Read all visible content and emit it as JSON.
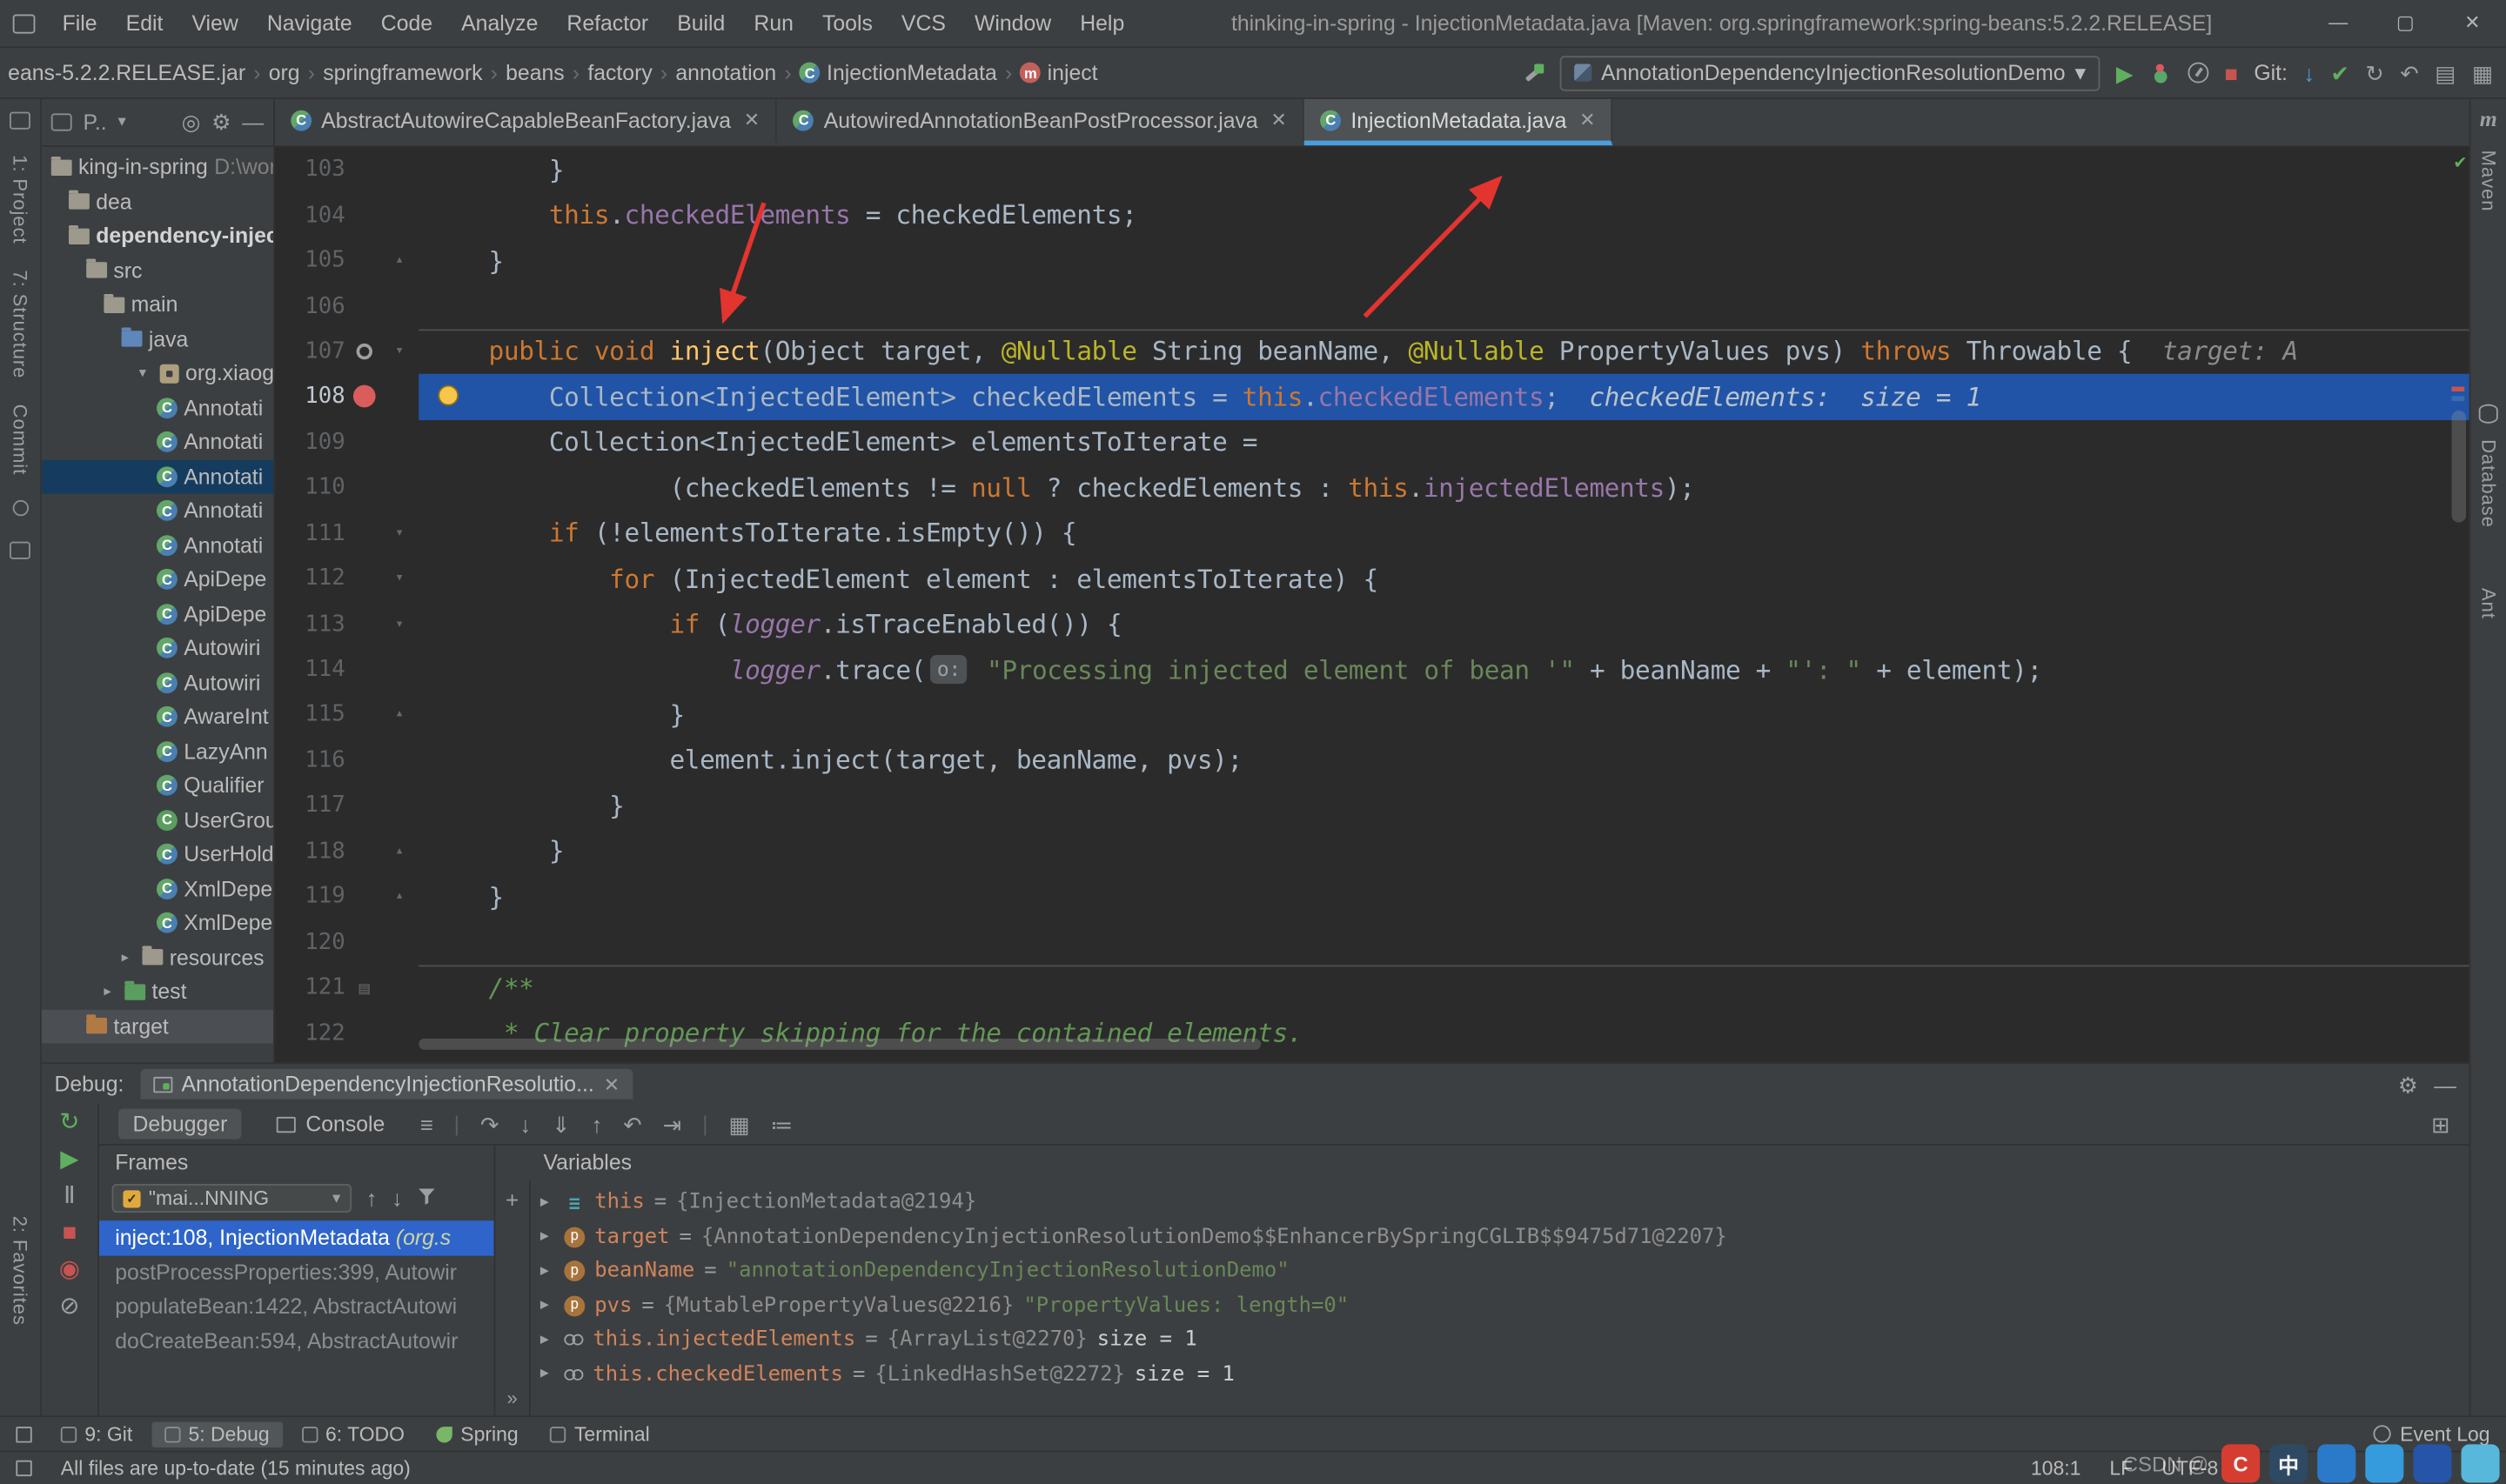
{
  "theme": {
    "editor_bg": "#2b2b2b",
    "panel_bg": "#3c3f41",
    "exec_line": "#2154a6",
    "breakpoint": "#db5c5c",
    "selection": "#2f65ca",
    "tab_underline": "#4a9edd",
    "keyword": "#cc7832",
    "string": "#6a8759",
    "field": "#9876aa",
    "comment": "#629755",
    "annotation": "#bbb529",
    "method": "#ffc66d",
    "annotation_arrow": "#e3342f"
  },
  "titlebar": {
    "menu": [
      "File",
      "Edit",
      "View",
      "Navigate",
      "Code",
      "Analyze",
      "Refactor",
      "Build",
      "Run",
      "Tools",
      "VCS",
      "Window",
      "Help"
    ],
    "title": "thinking-in-spring - InjectionMetadata.java [Maven: org.springframework:spring-beans:5.2.2.RELEASE]",
    "window_controls": [
      "minimize",
      "maximize",
      "close"
    ]
  },
  "navbar": {
    "breadcrumbs": [
      {
        "label": "eans-5.2.2.RELEASE.jar"
      },
      {
        "label": "org"
      },
      {
        "label": "springframework"
      },
      {
        "label": "beans"
      },
      {
        "label": "factory"
      },
      {
        "label": "annotation"
      },
      {
        "label": "InjectionMetadata",
        "icon": "class"
      },
      {
        "label": "inject",
        "icon": "method"
      }
    ],
    "run_config": "AnnotationDependencyInjectionResolutionDemo",
    "git_label": "Git:",
    "run_icons": [
      "run-icon",
      "debug-icon",
      "profiler-icon",
      "stop-icon"
    ],
    "git_icons": [
      "update-project-icon",
      "commit-icon",
      "history-icon",
      "rollback-icon"
    ],
    "right_icons": [
      "layout-icon",
      "hide-windows-icon"
    ]
  },
  "tabs": [
    {
      "label": "AbstractAutowireCapableBeanFactory.java",
      "active": false
    },
    {
      "label": "AutowiredAnnotationBeanPostProcessor.java",
      "active": false
    },
    {
      "label": "InjectionMetadata.java",
      "active": true
    }
  ],
  "left_stripe": {
    "top": [
      "1: Project",
      "7: Structure",
      "Commit"
    ],
    "bottom": [
      "2: Favorites"
    ]
  },
  "right_stripe": [
    "Maven",
    "Database",
    "Ant"
  ],
  "project": {
    "selector": "P..",
    "tree": [
      {
        "name": "king-in-spring",
        "suffix": " D:\\wor",
        "icon": "folder",
        "indent": 0
      },
      {
        "name": "dea",
        "icon": "folder",
        "indent": 1
      },
      {
        "name": "dependency-injection",
        "icon": "folder",
        "indent": 1,
        "bold": true
      },
      {
        "name": "src",
        "icon": "folder",
        "indent": 2
      },
      {
        "name": "main",
        "icon": "folder",
        "indent": 3
      },
      {
        "name": "java",
        "icon": "srcfolder",
        "indent": 4
      },
      {
        "name": "org.xiaoge.t",
        "icon": "package",
        "indent": 5,
        "arrow": "down"
      },
      {
        "name": "Annotati",
        "icon": "class",
        "indent": 6
      },
      {
        "name": "Annotati",
        "icon": "class",
        "indent": 6
      },
      {
        "name": "Annotati",
        "icon": "class",
        "indent": 6,
        "selected": "blue"
      },
      {
        "name": "Annotati",
        "icon": "class",
        "indent": 6
      },
      {
        "name": "Annotati",
        "icon": "class",
        "indent": 6
      },
      {
        "name": "ApiDepe",
        "icon": "class",
        "indent": 6
      },
      {
        "name": "ApiDepe",
        "icon": "class",
        "indent": 6
      },
      {
        "name": "Autowiri",
        "icon": "class",
        "indent": 6
      },
      {
        "name": "Autowiri",
        "icon": "class",
        "indent": 6
      },
      {
        "name": "AwareInt",
        "icon": "class",
        "indent": 6
      },
      {
        "name": "LazyAnn",
        "icon": "class",
        "indent": 6
      },
      {
        "name": "Qualifier",
        "icon": "class",
        "indent": 6
      },
      {
        "name": "UserGrou",
        "icon": "class-green",
        "indent": 6
      },
      {
        "name": "UserHold",
        "icon": "class",
        "indent": 6
      },
      {
        "name": "XmlDepe",
        "icon": "class",
        "indent": 6
      },
      {
        "name": "XmlDepe",
        "icon": "class",
        "indent": 6
      },
      {
        "name": "resources",
        "icon": "folder",
        "indent": 4,
        "arrow": "right"
      },
      {
        "name": "test",
        "icon": "folder-green",
        "indent": 3,
        "arrow": "right"
      },
      {
        "name": "target",
        "icon": "folder-excluded",
        "indent": 2,
        "selected": "gray"
      }
    ]
  },
  "editor": {
    "lines": [
      {
        "n": 103,
        "tokens": [
          [
            "t",
            "        }"
          ]
        ]
      },
      {
        "n": 104,
        "tokens": [
          [
            "t",
            "        "
          ],
          [
            "k",
            "this"
          ],
          [
            "t",
            "."
          ],
          [
            "f",
            "checkedElements"
          ],
          [
            "t",
            " = checkedElements;"
          ]
        ]
      },
      {
        "n": 105,
        "fold": "up",
        "tokens": [
          [
            "t",
            "    }"
          ]
        ]
      },
      {
        "n": 106,
        "tokens": []
      },
      {
        "n": 107,
        "sep": true,
        "fold": "down",
        "gicon": "method-marker-icon",
        "tokens": [
          [
            "t",
            "    "
          ],
          [
            "k",
            "public"
          ],
          [
            "t",
            " "
          ],
          [
            "k",
            "void"
          ],
          [
            "t",
            " "
          ],
          [
            "m",
            "inject"
          ],
          [
            "t",
            "(Object target, "
          ],
          [
            "a",
            "@Nullable"
          ],
          [
            "t",
            " String beanName, "
          ],
          [
            "a",
            "@Nullable"
          ],
          [
            "t",
            " PropertyValues pvs) "
          ],
          [
            "k",
            "throws"
          ],
          [
            "t",
            " Throwable {"
          ],
          [
            "h",
            "  target: A"
          ]
        ]
      },
      {
        "n": 108,
        "exec": true,
        "breakpoint": true,
        "bulb": true,
        "tokens": [
          [
            "t",
            "        Collection<InjectedElement> checkedElements = "
          ],
          [
            "k",
            "this"
          ],
          [
            "t",
            "."
          ],
          [
            "f",
            "checkedElements"
          ],
          [
            "t",
            ";"
          ],
          [
            "h2",
            "  checkedElements:  size = 1"
          ]
        ]
      },
      {
        "n": 109,
        "tokens": [
          [
            "t",
            "        Collection<InjectedElement> elementsToIterate ="
          ]
        ]
      },
      {
        "n": 110,
        "tokens": [
          [
            "t",
            "                (checkedElements != "
          ],
          [
            "k",
            "null"
          ],
          [
            "t",
            " ? checkedElements : "
          ],
          [
            "k",
            "this"
          ],
          [
            "t",
            "."
          ],
          [
            "f",
            "injectedElements"
          ],
          [
            "t",
            ");"
          ]
        ]
      },
      {
        "n": 111,
        "fold": "down",
        "tokens": [
          [
            "t",
            "        "
          ],
          [
            "k",
            "if"
          ],
          [
            "t",
            " (!elementsToIterate.isEmpty()) {"
          ]
        ]
      },
      {
        "n": 112,
        "fold": "down",
        "tokens": [
          [
            "t",
            "            "
          ],
          [
            "k",
            "for"
          ],
          [
            "t",
            " (InjectedElement element : elementsToIterate) {"
          ]
        ]
      },
      {
        "n": 113,
        "fold": "down",
        "tokens": [
          [
            "t",
            "                "
          ],
          [
            "k",
            "if"
          ],
          [
            "t",
            " ("
          ],
          [
            "fi",
            "logger"
          ],
          [
            "t",
            ".isTraceEnabled()) {"
          ]
        ]
      },
      {
        "n": 114,
        "tokens": [
          [
            "t",
            "                    "
          ],
          [
            "fi",
            "logger"
          ],
          [
            "t",
            ".trace("
          ],
          [
            "chip",
            "o:"
          ],
          [
            "t",
            " "
          ],
          [
            "s",
            "\"Processing injected element of bean '\""
          ],
          [
            "t",
            " + beanName + "
          ],
          [
            "s",
            "\"': \""
          ],
          [
            "t",
            " + element);"
          ]
        ]
      },
      {
        "n": 115,
        "fold": "up",
        "tokens": [
          [
            "t",
            "                }"
          ]
        ]
      },
      {
        "n": 116,
        "tokens": [
          [
            "t",
            "                element.inject(target, beanName, pvs);"
          ]
        ]
      },
      {
        "n": 117,
        "tokens": [
          [
            "t",
            "            }"
          ]
        ]
      },
      {
        "n": 118,
        "fold": "up",
        "tokens": [
          [
            "t",
            "        }"
          ]
        ]
      },
      {
        "n": 119,
        "fold": "up",
        "tokens": [
          [
            "t",
            "    }"
          ]
        ]
      },
      {
        "n": 120,
        "tokens": []
      },
      {
        "n": 121,
        "sep": true,
        "gicon": "doc-icon",
        "tokens": [
          [
            "c",
            "    /**"
          ]
        ]
      },
      {
        "n": 122,
        "tokens": [
          [
            "c",
            "     * Clear property skipping for the contained elements."
          ]
        ]
      }
    ]
  },
  "debug": {
    "label": "Debug:",
    "tab_title": "AnnotationDependencyInjectionResolutio...",
    "tabs": [
      {
        "label": "Debugger",
        "active": true,
        "icon": null
      },
      {
        "label": "Console",
        "active": false,
        "icon": "console-icon"
      }
    ],
    "left_icons": [
      "rerun-icon",
      "resume-icon",
      "pause-icon",
      "stop-icon",
      "view-breakpoints-icon",
      "mute-breakpoints-icon"
    ],
    "step_icons": [
      "settings-menu-icon",
      "step-over-icon",
      "step-into-icon",
      "force-step-into-icon",
      "step-out-icon",
      "drop-frame-icon",
      "run-to-cursor-icon",
      "evaluate-expression-icon",
      "layout-settings-icon"
    ],
    "frames": {
      "title": "Frames",
      "thread": "\"mai...NNING",
      "toolbar_icons": [
        "frame-up-icon",
        "frame-down-icon",
        "filter-icon"
      ],
      "rows": [
        {
          "text": "inject:108, InjectionMetadata ",
          "pkg": "(org.s",
          "selected": true
        },
        {
          "text": "postProcessProperties:399, Autowir",
          "selected": false
        },
        {
          "text": "populateBean:1422, AbstractAutowi",
          "selected": false
        },
        {
          "text": "doCreateBean:594, AbstractAutowir",
          "selected": false
        }
      ]
    },
    "variables": {
      "title": "Variables",
      "rows": [
        {
          "icon": "object",
          "name": "this",
          "eq": " = ",
          "ref": "{InjectionMetadata@2194}"
        },
        {
          "icon": "param",
          "name": "target",
          "eq": " = ",
          "ref": "{AnnotationDependencyInjectionResolutionDemo$$EnhancerBySpringCGLIB$$9475d71@2207}"
        },
        {
          "icon": "param",
          "name": "beanName",
          "eq": " = ",
          "str": "\"annotationDependencyInjectionResolutionDemo\""
        },
        {
          "icon": "param",
          "name": "pvs",
          "eq": " = ",
          "ref": "{MutablePropertyValues@2216}",
          "str": " \"PropertyValues: length=0\""
        },
        {
          "icon": "watch",
          "name": "this.injectedElements",
          "eq": " = ",
          "ref": "{ArrayList@2270}",
          "size": "  size = 1"
        },
        {
          "icon": "watch",
          "name": "this.checkedElements",
          "eq": " = ",
          "ref": "{LinkedHashSet@2272}",
          "size": "  size = 1"
        }
      ]
    }
  },
  "toolwindow_bar": {
    "items": [
      {
        "label": "9: Git",
        "active": false,
        "icon": "git-icon"
      },
      {
        "label": "5: Debug",
        "active": true,
        "icon": "debug-tw-icon"
      },
      {
        "label": "6: TODO",
        "active": false,
        "icon": "todo-icon"
      },
      {
        "label": "Spring",
        "active": false,
        "icon": "spring-leaf-icon"
      },
      {
        "label": "Terminal",
        "active": false,
        "icon": "terminal-icon"
      }
    ],
    "event_log": "Event Log"
  },
  "status_bar": {
    "message": "All files are up-to-date (15 minutes ago)",
    "position": "108:1",
    "line_ending": "LF",
    "encoding": "UTF-8"
  },
  "watermark": {
    "text": "CSDN @",
    "brand": "CSDN",
    "icons": [
      "csdn-logo-icon",
      "ime-chinese-icon",
      "taskbar-app-icon",
      "taskbar-app-icon",
      "taskbar-app-icon",
      "taskbar-app-icon"
    ]
  }
}
